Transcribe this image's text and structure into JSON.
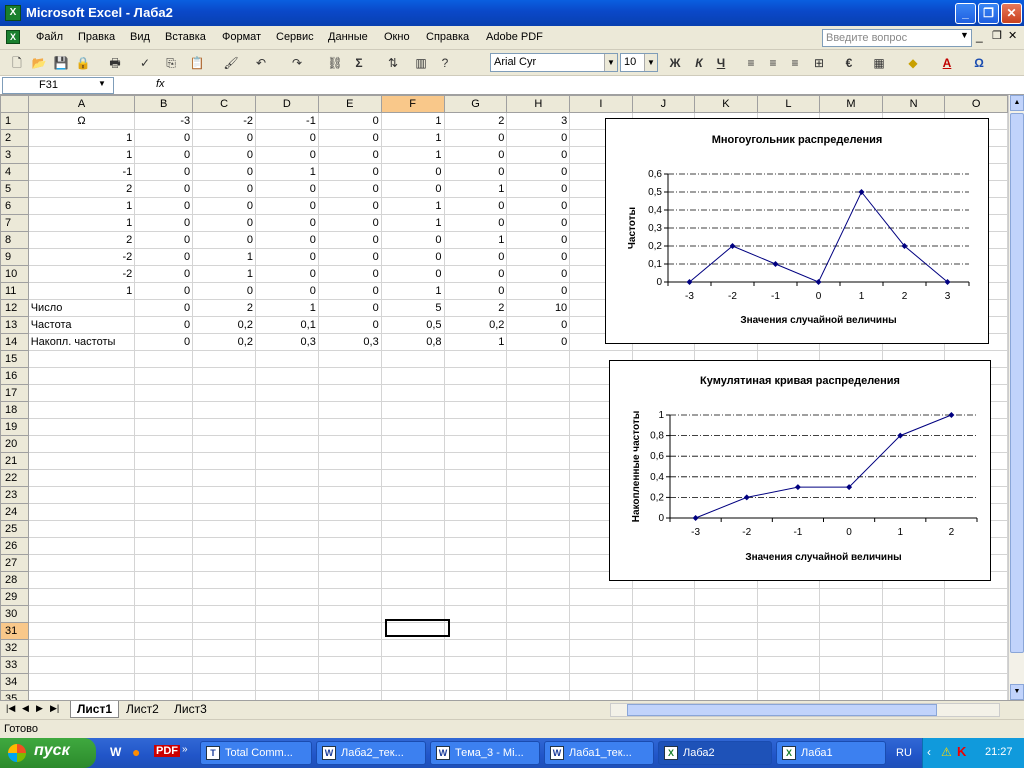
{
  "window": {
    "title": "Microsoft Excel - Лаба2",
    "btn_min": "_",
    "btn_max": "❐",
    "btn_close": "✕"
  },
  "menu": {
    "items": [
      "Файл",
      "Правка",
      "Вид",
      "Вставка",
      "Формат",
      "Сервис",
      "Данные",
      "Окно",
      "Справка",
      "Adobe PDF"
    ],
    "help_placeholder": "Введите вопрос"
  },
  "toolbar": {
    "font": "Arial Cyr",
    "size": "10",
    "bold": "Ж",
    "italic": "К",
    "underline": "Ч",
    "sigma": "Σ"
  },
  "formula": {
    "name_box": "F31",
    "fx": "fx",
    "content": ""
  },
  "columns": [
    "A",
    "B",
    "C",
    "D",
    "E",
    "F",
    "G",
    "H",
    "I",
    "J",
    "K",
    "L",
    "M",
    "N",
    "O"
  ],
  "selected_col": "F",
  "selected_row": 31,
  "rows": [
    [
      "Ω",
      "-3",
      "-2",
      "-1",
      "0",
      "1",
      "2",
      "3"
    ],
    [
      "1",
      "0",
      "0",
      "0",
      "0",
      "1",
      "0",
      "0"
    ],
    [
      "1",
      "0",
      "0",
      "0",
      "0",
      "1",
      "0",
      "0"
    ],
    [
      "-1",
      "0",
      "0",
      "1",
      "0",
      "0",
      "0",
      "0"
    ],
    [
      "2",
      "0",
      "0",
      "0",
      "0",
      "0",
      "1",
      "0"
    ],
    [
      "1",
      "0",
      "0",
      "0",
      "0",
      "1",
      "0",
      "0"
    ],
    [
      "1",
      "0",
      "0",
      "0",
      "0",
      "1",
      "0",
      "0"
    ],
    [
      "2",
      "0",
      "0",
      "0",
      "0",
      "0",
      "1",
      "0"
    ],
    [
      "-2",
      "0",
      "1",
      "0",
      "0",
      "0",
      "0",
      "0"
    ],
    [
      "-2",
      "0",
      "1",
      "0",
      "0",
      "0",
      "0",
      "0"
    ],
    [
      "1",
      "0",
      "0",
      "0",
      "0",
      "1",
      "0",
      "0"
    ],
    [
      "Число",
      "0",
      "2",
      "1",
      "0",
      "5",
      "2",
      "10"
    ],
    [
      "Частота",
      "0",
      "0,2",
      "0,1",
      "0",
      "0,5",
      "0,2",
      "0"
    ],
    [
      "Накопл. частоты",
      "0",
      "0,2",
      "0,3",
      "0,3",
      "0,8",
      "1",
      "0"
    ]
  ],
  "row_count": 35,
  "chart_data": [
    {
      "type": "line",
      "title": "Многоугольник распределения",
      "xlabel": "Значения случайной величины",
      "ylabel": "Частоты",
      "categories": [
        "-3",
        "-2",
        "-1",
        "0",
        "1",
        "2",
        "3"
      ],
      "values": [
        0,
        0.2,
        0.1,
        0,
        0.5,
        0.2,
        0
      ],
      "ylim": [
        0,
        0.6
      ],
      "yticks": [
        "0",
        "0,1",
        "0,2",
        "0,3",
        "0,4",
        "0,5",
        "0,6"
      ],
      "color": "#000080",
      "grid": true
    },
    {
      "type": "line",
      "title": "Кумулятиная кривая распределения",
      "xlabel": "Значения случайной величины",
      "ylabel": "Накопленные частоты",
      "categories": [
        "-3",
        "-2",
        "-1",
        "0",
        "1",
        "2"
      ],
      "values": [
        0,
        0.2,
        0.3,
        0.3,
        0.8,
        1
      ],
      "ylim": [
        0,
        1
      ],
      "yticks": [
        "0",
        "0,2",
        "0,4",
        "0,6",
        "0,8",
        "1"
      ],
      "color": "#000080",
      "grid": true
    }
  ],
  "sheets": [
    "Лист1",
    "Лист2",
    "Лист3"
  ],
  "active_sheet": "Лист1",
  "status": "Готово",
  "taskbar": {
    "start": "пуск",
    "tasks": [
      "Total Comm...",
      "Лаба2_тек...",
      "Тема_3 - Mi...",
      "Лаба1_тек...",
      "Лаба2",
      "Лаба1"
    ],
    "active_task": "Лаба2",
    "lang": "RU",
    "time": "21:27"
  }
}
